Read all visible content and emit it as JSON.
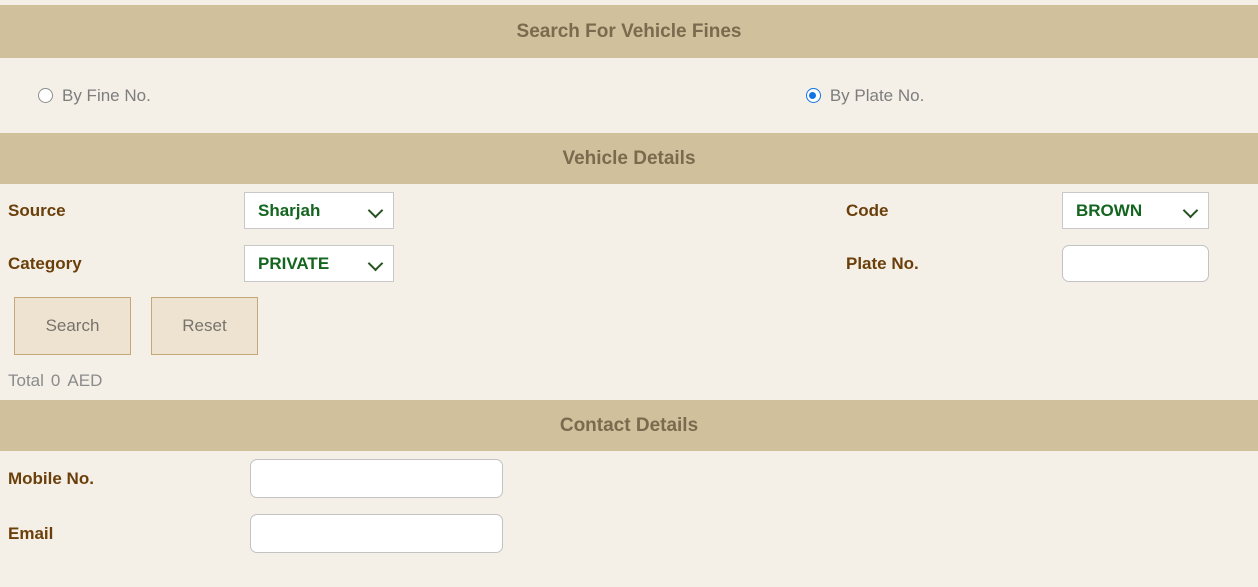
{
  "search_section": {
    "title": "Search For Vehicle Fines",
    "options": [
      {
        "label": "By Fine No.",
        "selected": false,
        "name": "radio-by-fine-no"
      },
      {
        "label": "By Plate No.",
        "selected": true,
        "name": "radio-by-plate-no"
      }
    ]
  },
  "vehicle_section": {
    "title": "Vehicle Details",
    "fields": {
      "source": {
        "label": "Source",
        "value": "Sharjah"
      },
      "category": {
        "label": "Category",
        "value": "PRIVATE"
      },
      "code": {
        "label": "Code",
        "value": "BROWN"
      },
      "plate_no": {
        "label": "Plate No.",
        "value": "",
        "placeholder": ""
      }
    },
    "buttons": {
      "search": "Search",
      "reset": "Reset"
    },
    "total": {
      "label": "Total",
      "amount": "0",
      "currency": "AED"
    }
  },
  "contact_section": {
    "title": "Contact Details",
    "fields": {
      "mobile_no": {
        "label": "Mobile No.",
        "value": "",
        "placeholder": ""
      },
      "email": {
        "label": "Email",
        "value": "",
        "placeholder": ""
      }
    }
  },
  "colors": {
    "bar_background": "#d0c09c",
    "bar_text": "#7b6a4e",
    "page_background": "#f4f0e8",
    "label_text": "#6b3f0a",
    "select_value_text": "#14651f",
    "radio_selected": "#1273e6",
    "button_background": "#eee3d1",
    "button_border": "#c4a878",
    "muted_text": "#8b8b8b"
  }
}
